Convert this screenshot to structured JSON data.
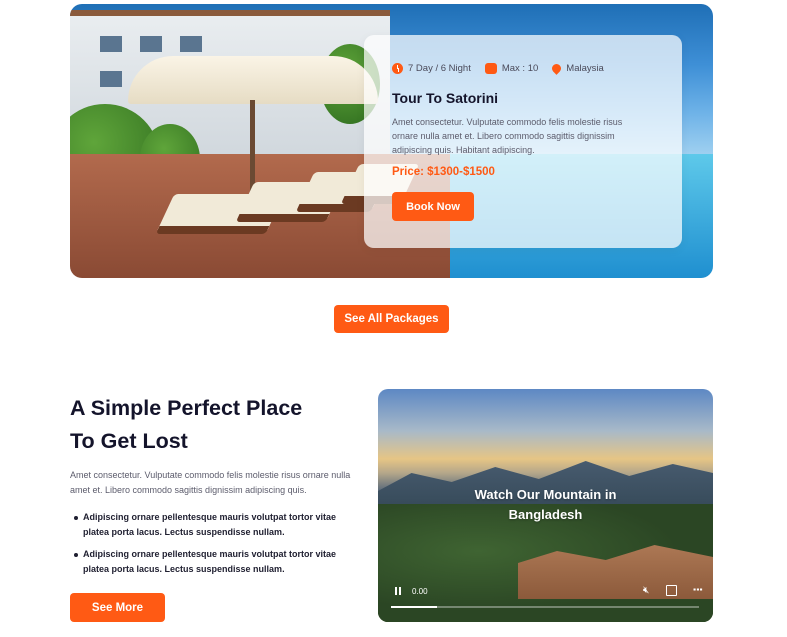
{
  "tour": {
    "duration": "7 Day / 6 Night",
    "capacity": "Max : 10",
    "location": "Malaysia",
    "title": "Tour To Satorini",
    "description": "Amet consectetur. Vulputate commodo felis molestie risus  ornare nulla amet et. Libero commodo sagittis dignissim adipiscing quis. Habitant adipiscing.",
    "price": "Price: $1300-$1500",
    "book_label": "Book Now"
  },
  "packages": {
    "see_all_label": "See All Packages"
  },
  "about": {
    "heading_line1": "A Simple Perfect Place",
    "heading_line2": "To Get Lost",
    "lead": "Amet consectetur. Vulputate commodo felis molestie risus  ornare nulla amet et. Libero commodo sagittis dignissim adipiscing quis.",
    "bullets": [
      "Adipiscing ornare pellentesque mauris volutpat tortor vitae platea porta lacus. Lectus suspendisse nullam.",
      "Adipiscing ornare pellentesque mauris volutpat tortor vitae platea porta lacus. Lectus suspendisse nullam."
    ],
    "see_more_label": "See More"
  },
  "video": {
    "title_line1": "Watch Our Mountain in",
    "title_line2": "Bangladesh",
    "time": "0.00",
    "progress": 0.15
  },
  "colors": {
    "accent": "#ff5a14",
    "heading": "#14142b"
  },
  "icons": {
    "duration": "clock-icon",
    "capacity": "group-icon",
    "location": "map-pin-icon",
    "play": "pause-icon",
    "mute": "volume-mute-icon",
    "fullscreen": "fullscreen-icon",
    "menu": "more-vertical-icon"
  }
}
